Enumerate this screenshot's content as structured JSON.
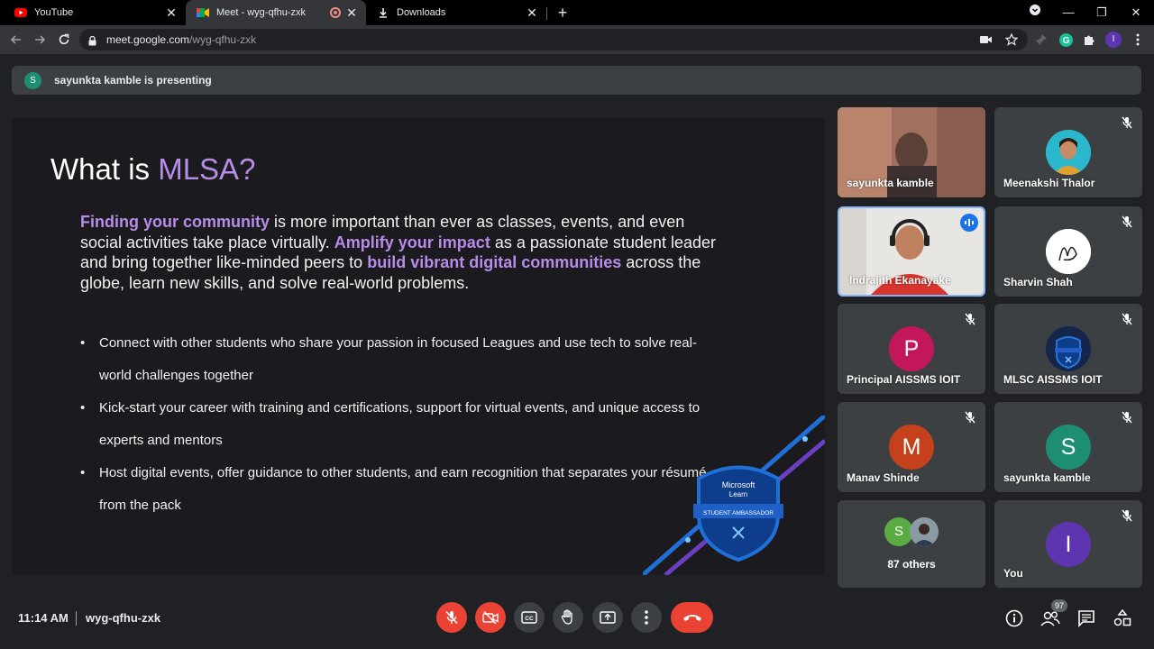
{
  "browser": {
    "tabs": [
      {
        "title": "YouTube",
        "icon": "youtube-icon"
      },
      {
        "title": "Meet - wyg-qfhu-zxk",
        "icon": "meet-icon",
        "active": true
      },
      {
        "title": "Downloads",
        "icon": "download-icon"
      }
    ],
    "url_host": "meet.google.com",
    "url_path": "/wyg-qfhu-zxk",
    "profile_initial": "I"
  },
  "presenting_banner": {
    "avatar_initial": "S",
    "text": "sayunkta kamble is presenting"
  },
  "slide": {
    "title_plain": "What is ",
    "title_highlight": "MLSA?",
    "para": {
      "hl1": "Finding your community",
      "t1": " is more important than ever as classes, events, and even social activities take place virtually. ",
      "hl2": "Amplify your impact",
      "t2": " as a passionate student leader and bring together like-minded peers to ",
      "hl3": "build vibrant digital communities",
      "t3": " across the globe, learn new skills, and solve real-world problems."
    },
    "bullets": [
      "Connect with other students who share your passion in focused Leagues and use tech to solve real-world challenges together",
      "Kick-start your career with training and certifications, support for virtual events, and unique access to experts and mentors",
      "Host digital events, offer guidance to other students, and earn recognition that separates your résumé from the pack"
    ],
    "badge": {
      "line1": "Microsoft",
      "line2": "Learn",
      "ribbon": "STUDENT AMBASSADOR"
    }
  },
  "participants": [
    {
      "name": "sayunkta kamble",
      "type": "video"
    },
    {
      "name": "Meenakshi Thalor",
      "type": "photo",
      "muted": true
    },
    {
      "name": "Indrajith Ekanayake",
      "type": "video",
      "speaking": true
    },
    {
      "name": "Sharvin Shah",
      "type": "photo",
      "muted": true
    },
    {
      "name": "Principal AISSMS IOIT",
      "initial": "P",
      "color": "#c2185b",
      "muted": true
    },
    {
      "name": "MLSC AISSMS IOIT",
      "type": "photo",
      "muted": true
    },
    {
      "name": "Manav Shinde",
      "initial": "M",
      "color": "#c5411b",
      "muted": true
    },
    {
      "name": "sayunkta kamble",
      "initial": "S",
      "color": "#1e8e73",
      "muted": true
    },
    {
      "name": "87 others",
      "initial": "S",
      "color": "#5bab44"
    },
    {
      "name": "You",
      "initial": "I",
      "color": "#5e35b1",
      "muted": true
    }
  ],
  "bottom": {
    "time": "11:14 AM",
    "meeting_code": "wyg-qfhu-zxk",
    "people_count": "97"
  },
  "colors": {
    "accent_purple": "#b68ee6",
    "end_call": "#ea4335",
    "speaking_border": "#8ab4f8"
  }
}
